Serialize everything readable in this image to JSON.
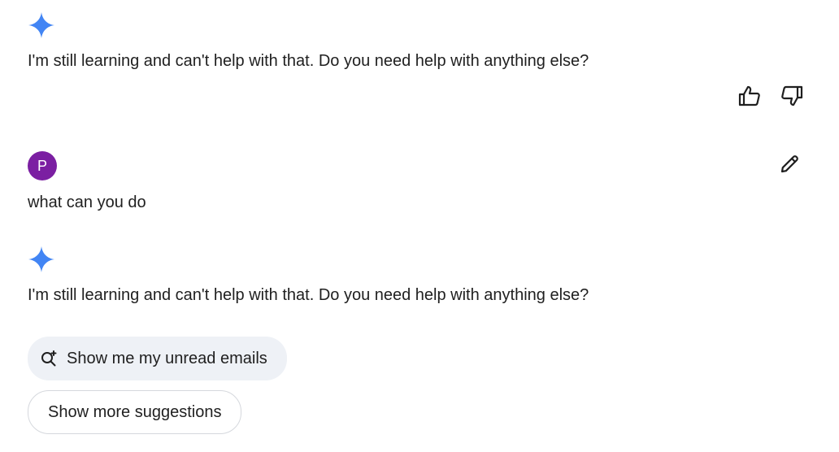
{
  "conversation": {
    "first_response": {
      "icon": "gemini-sparkle-icon",
      "text": "I'm still learning and can't help with that. Do you need help with anything else?",
      "feedback": {
        "thumbs_up_icon": "thumbs-up-icon",
        "thumbs_down_icon": "thumbs-down-icon"
      }
    },
    "user_message": {
      "avatar_letter": "P",
      "avatar_color": "#7b1fa2",
      "text": "what can you do",
      "edit_icon": "pencil-icon"
    },
    "second_response": {
      "icon": "gemini-sparkle-icon",
      "text": "I'm still learning and can't help with that. Do you need help with anything else?"
    }
  },
  "suggestions": {
    "primary": {
      "icon": "search-sparkle-icon",
      "label": "Show me my unread emails"
    },
    "more_label": "Show more suggestions"
  },
  "colors": {
    "sparkle": "#4285f4",
    "chip_background": "#eef1f6",
    "text": "#1f1f1f"
  }
}
